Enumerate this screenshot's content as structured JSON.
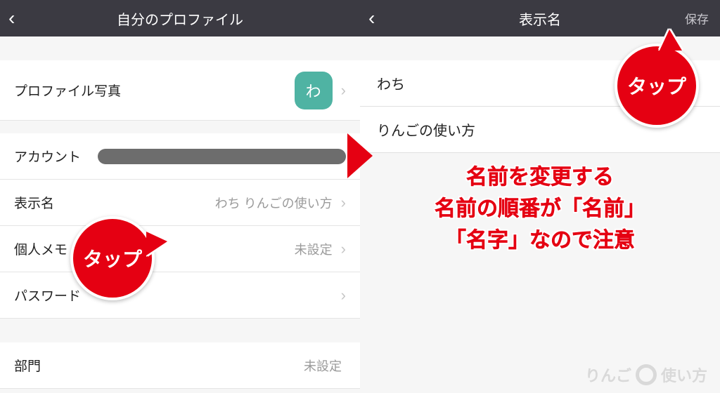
{
  "left": {
    "header_title": "自分のプロファイル",
    "rows": {
      "photo_label": "プロファイル写真",
      "avatar_char": "わ",
      "account_label": "アカウント",
      "display_name_label": "表示名",
      "display_name_value": "わち りんごの使い方",
      "memo_label": "個人メモ",
      "memo_value": "未設定",
      "password_label": "パスワード",
      "department_label": "部門",
      "department_value": "未設定"
    }
  },
  "right": {
    "header_title": "表示名",
    "save_label": "保存",
    "first_name": "わち",
    "last_name": "りんごの使い方"
  },
  "annotations": {
    "tap_label": "タップ",
    "caption_l1": "名前を変更する",
    "caption_l2": "名前の順番が「名前」",
    "caption_l3": "「名字」なので注意"
  },
  "watermark": {
    "left": "りんご",
    "right": "使い方"
  }
}
